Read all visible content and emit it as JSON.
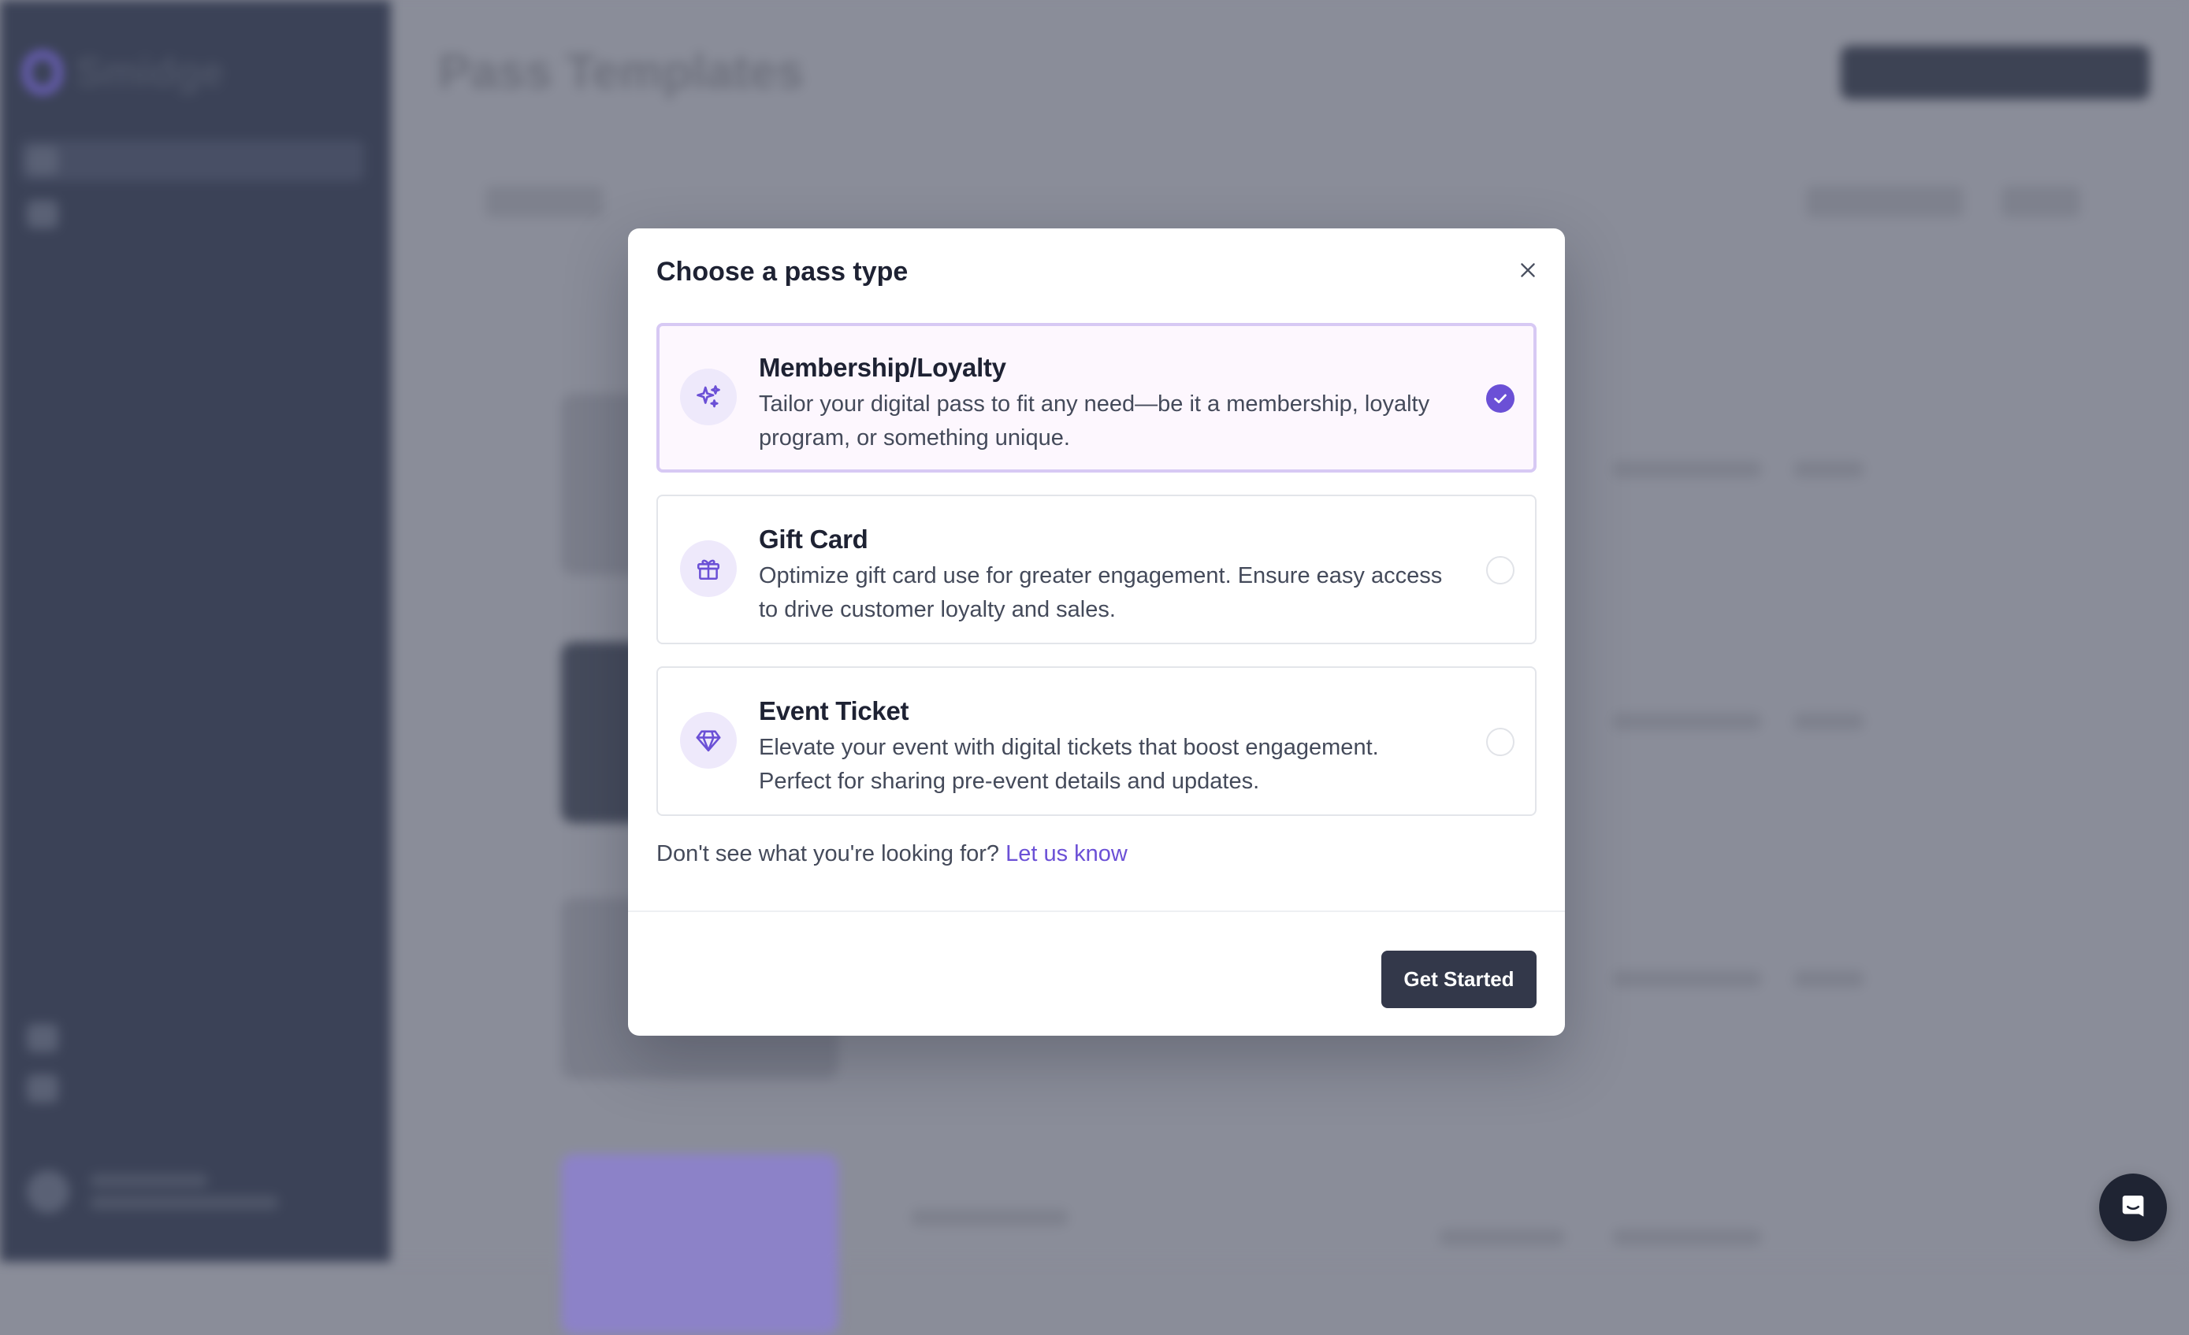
{
  "background": {
    "app_name": "Smidge",
    "page_title": "Pass Templates"
  },
  "modal": {
    "title": "Choose a pass type",
    "options": [
      {
        "title": "Membership/Loyalty",
        "description": "Tailor your digital pass to fit any need—be it a membership, loyalty program, or something unique.",
        "icon": "sparkles-icon",
        "selected": true
      },
      {
        "title": "Gift Card",
        "description": "Optimize gift card use for greater engagement. Ensure easy access to drive customer loyalty and sales.",
        "icon": "gift-icon",
        "selected": false
      },
      {
        "title": "Event Ticket",
        "description": "Elevate your event with digital tickets that boost engagement. Perfect for sharing pre-event details and updates.",
        "icon": "diamond-icon",
        "selected": false
      }
    ],
    "help_text": "Don't see what you're looking for? ",
    "help_link": "Let us know",
    "cta_label": "Get Started"
  },
  "colors": {
    "accent": "#6b50d6",
    "selected_border": "#d7c9f4",
    "selected_bg": "#fdf7fe",
    "button_bg": "#33384a",
    "sidebar_bg": "#3b4257"
  }
}
